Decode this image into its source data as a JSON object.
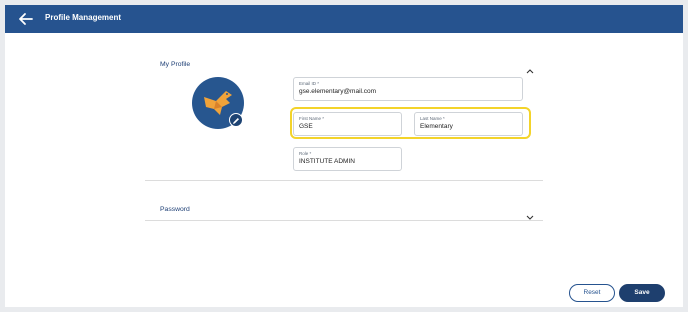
{
  "header": {
    "title": "Profile Management",
    "back_icon": "arrow-left-icon",
    "background": "#26538f"
  },
  "profile_section": {
    "title": "My Profile",
    "expanded": true
  },
  "fields": {
    "email": {
      "label": "Email ID *",
      "value": "gse.elementary@mail.com"
    },
    "first_name": {
      "label": "First Name *",
      "value": "GSE"
    },
    "last_name": {
      "label": "Last Name *",
      "value": "Elementary"
    },
    "role": {
      "label": "Role *",
      "value": "INSTITUTE ADMIN"
    }
  },
  "password_section": {
    "title": "Password",
    "expanded": false
  },
  "actions": {
    "reset_label": "Reset",
    "save_label": "Save"
  },
  "colors": {
    "accent": "#26538f",
    "avatar_logo": "#f0a33a",
    "highlight": "#f3d32a"
  }
}
